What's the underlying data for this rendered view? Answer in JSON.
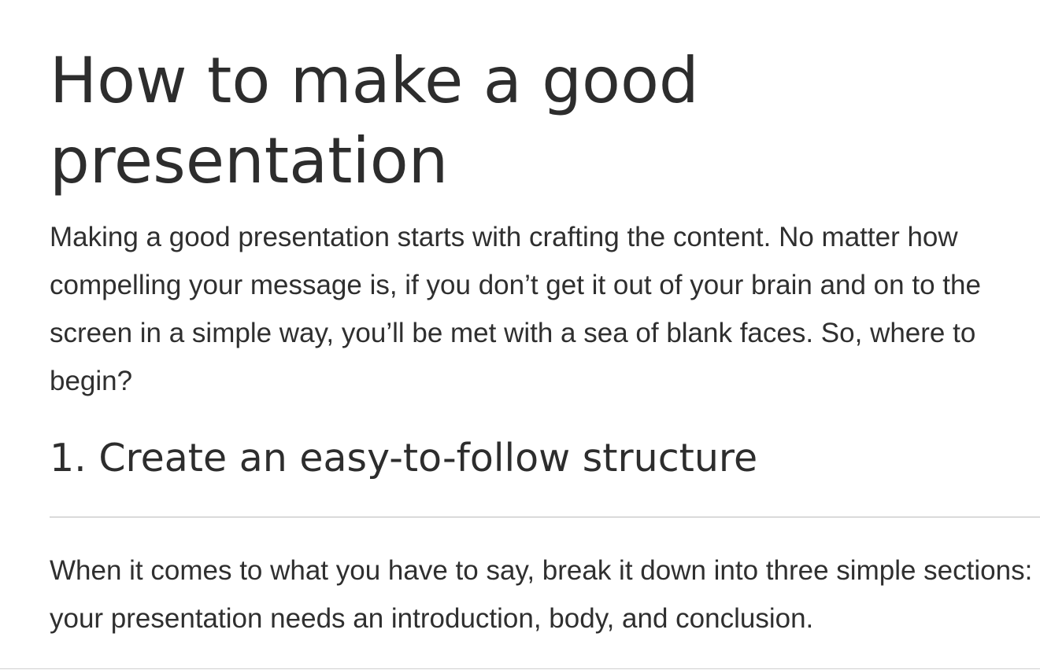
{
  "article": {
    "title": "How to make a good presentation",
    "intro": "Making a good presentation starts with crafting the content. No matter how compelling your message is, if you don’t get it out of your brain and on to the screen in a simple way, you’ll be met with a sea of blank faces. So, where to begin?",
    "sections": [
      {
        "heading": "1. Create an easy-to-follow structure",
        "body": "When it comes to what you have to say, break it down into three simple sections: your presentation needs an introduction, body, and conclusion."
      }
    ]
  },
  "colors": {
    "text": "#2f2f2f",
    "heading": "#2d2d2d",
    "divider": "#b9b9b9",
    "background": "#ffffff"
  }
}
